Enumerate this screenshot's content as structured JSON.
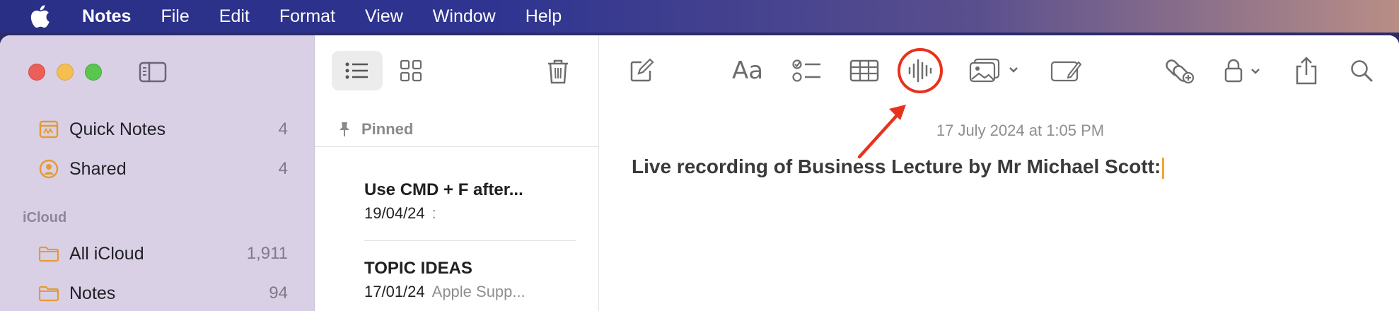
{
  "menubar": {
    "apple_icon": "apple-logo-icon",
    "app_name": "Notes",
    "items": [
      "File",
      "Edit",
      "Format",
      "View",
      "Window",
      "Help"
    ]
  },
  "sidebar": {
    "items": [
      {
        "label": "Quick Notes",
        "count": "4",
        "icon": "quick-notes-icon"
      },
      {
        "label": "Shared",
        "count": "4",
        "icon": "shared-person-icon"
      }
    ],
    "section_label": "iCloud",
    "folders": [
      {
        "label": "All iCloud",
        "count": "1,911",
        "icon": "folder-icon"
      },
      {
        "label": "Notes",
        "count": "94",
        "icon": "folder-icon"
      }
    ]
  },
  "notelist": {
    "pinned_label": "Pinned",
    "notes": [
      {
        "title": "Use CMD + F after...",
        "date": "19/04/24",
        "preview": ":"
      },
      {
        "title": "TOPIC IDEAS",
        "date": "17/01/24",
        "preview": "Apple Supp..."
      }
    ]
  },
  "editor": {
    "format_label": "Aa",
    "timestamp": "17 July 2024 at 1:05 PM",
    "heading": "Live recording of Business Lecture by Mr Michael Scott:"
  },
  "colors": {
    "accent_highlight": "#e8321e",
    "caret": "#f2a531",
    "folder_icon": "#e59a35",
    "sidebar_bg": "#d9d0e6"
  }
}
